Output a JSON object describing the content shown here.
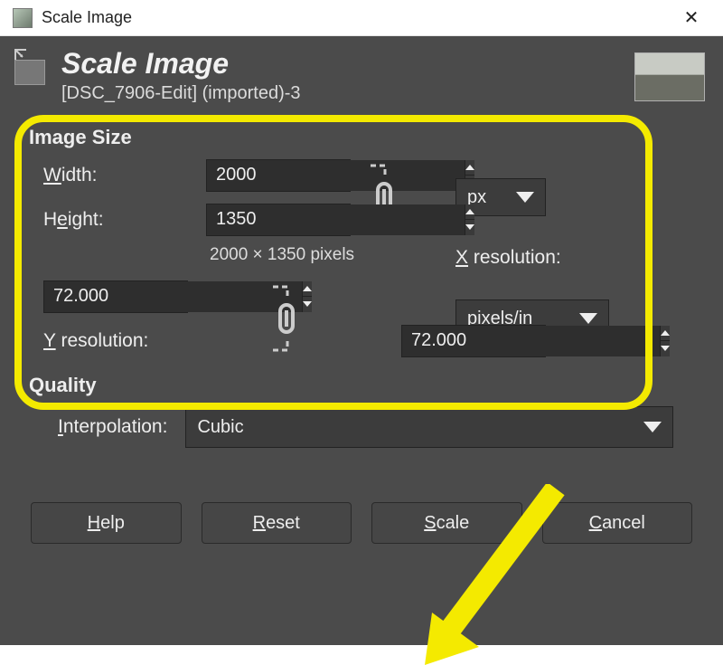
{
  "window": {
    "title": "Scale Image"
  },
  "header": {
    "title": "Scale Image",
    "subtitle": "[DSC_7906-Edit] (imported)-3"
  },
  "image_size": {
    "section_label": "Image Size",
    "width_label": "Width:",
    "width_value": "2000",
    "height_label": "Height:",
    "height_value": "1350",
    "unit_label": "px",
    "size_text": "2000 × 1350 pixels",
    "xres_label": "X resolution:",
    "xres_value": "72.000",
    "yres_label": "Y resolution:",
    "yres_value": "72.000",
    "res_unit_label": "pixels/in"
  },
  "quality": {
    "section_label": "Quality",
    "interp_label": "Interpolation:",
    "interp_value": "Cubic"
  },
  "buttons": {
    "help": "Help",
    "reset": "Reset",
    "scale": "Scale",
    "cancel": "Cancel"
  }
}
